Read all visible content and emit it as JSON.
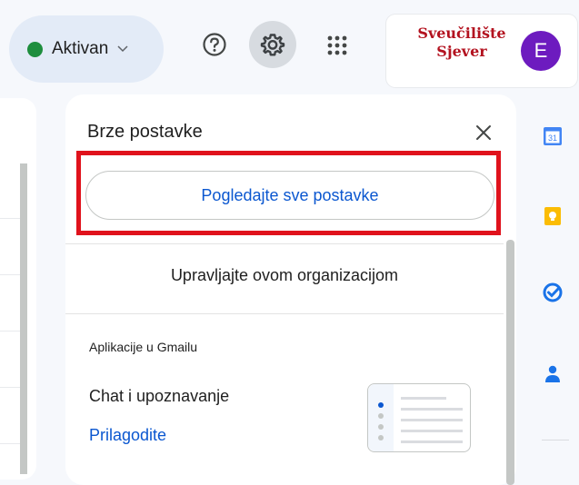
{
  "header": {
    "status_label": "Aktivan",
    "org_logo_line1": "Sveučilište",
    "org_logo_line2": "Sjever",
    "avatar_letter": "E"
  },
  "quick_settings": {
    "title": "Brze postavke",
    "see_all_button": "Pogledajte sve postavke",
    "manage_org_link": "Upravljajte ovom organizacijom",
    "apps_section_heading": "Aplikacije u Gmailu",
    "chat_label": "Chat i upoznavanje",
    "customize_link": "Prilagodite"
  },
  "side_rail": {
    "calendar_badge": "31",
    "icons": [
      "calendar-icon",
      "keep-icon",
      "tasks-icon",
      "contacts-icon"
    ]
  },
  "colors": {
    "accent_blue": "#0b57d0",
    "status_green": "#1e8e3e",
    "highlight_red": "#e0121c",
    "avatar_purple": "#6d1bbf",
    "org_red": "#b3121f"
  }
}
